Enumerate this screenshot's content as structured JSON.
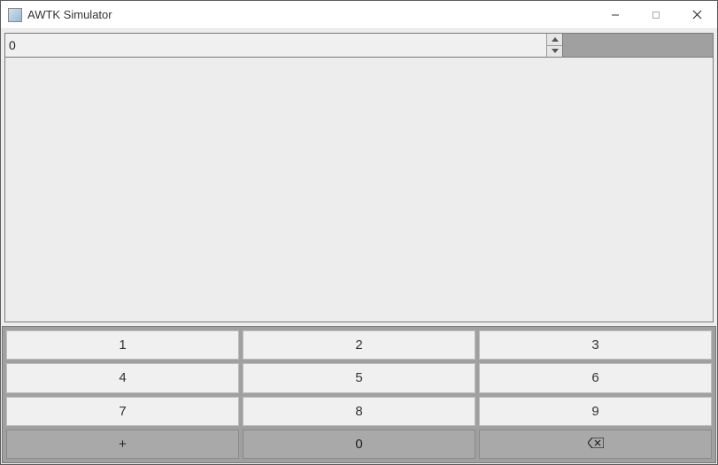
{
  "window": {
    "title": "AWTK Simulator"
  },
  "input": {
    "value": "0"
  },
  "keypad": {
    "r0": {
      "c0": "1",
      "c1": "2",
      "c2": "3"
    },
    "r1": {
      "c0": "4",
      "c1": "5",
      "c2": "6"
    },
    "r2": {
      "c0": "7",
      "c1": "8",
      "c2": "9"
    },
    "r3": {
      "c0": "+",
      "c1": "0"
    }
  }
}
